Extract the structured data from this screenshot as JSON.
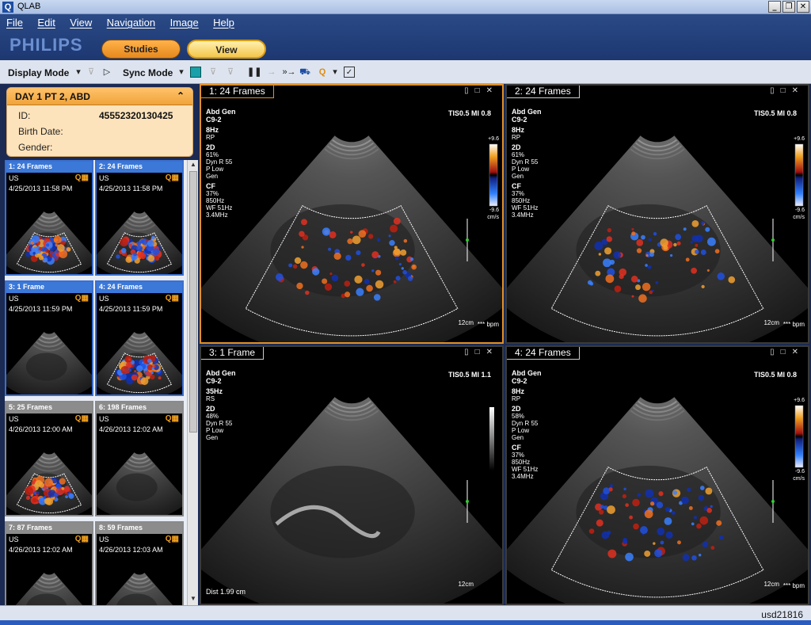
{
  "window": {
    "title": "QLAB",
    "icon_letter": "Q"
  },
  "menu": [
    "File",
    "Edit",
    "View",
    "Navigation",
    "Image",
    "Help"
  ],
  "brand": "PHILIPS",
  "tabs": {
    "studies": "Studies",
    "view": "View"
  },
  "toolbar": {
    "display_mode": "Display Mode",
    "sync_mode": "Sync Mode"
  },
  "patient": {
    "header": "DAY 1 PT 2, ABD",
    "id_label": "ID:",
    "id_value": "45552320130425",
    "birth_label": "Birth Date:",
    "gender_label": "Gender:"
  },
  "thumbnails": [
    {
      "title": "1: 24 Frames",
      "modality": "US",
      "date": "4/25/2013 11:58 PM",
      "selected": true,
      "doppler": true
    },
    {
      "title": "2: 24 Frames",
      "modality": "US",
      "date": "4/25/2013 11:58 PM",
      "selected": true,
      "doppler": true
    },
    {
      "title": "3: 1 Frame",
      "modality": "US",
      "date": "4/25/2013 11:59 PM",
      "selected": true,
      "doppler": false
    },
    {
      "title": "4: 24 Frames",
      "modality": "US",
      "date": "4/25/2013 11:59 PM",
      "selected": true,
      "doppler": true
    },
    {
      "title": "5: 25 Frames",
      "modality": "US",
      "date": "4/26/2013 12:00 AM",
      "selected": false,
      "doppler": true
    },
    {
      "title": "6: 198 Frames",
      "modality": "US",
      "date": "4/26/2013 12:02 AM",
      "selected": false,
      "doppler": false
    },
    {
      "title": "7: 87 Frames",
      "modality": "US",
      "date": "4/26/2013 12:02 AM",
      "selected": false,
      "doppler": false
    },
    {
      "title": "8: 59 Frames",
      "modality": "US",
      "date": "4/26/2013 12:03 AM",
      "selected": false,
      "doppler": false
    }
  ],
  "viewports": [
    {
      "tab": "1: 24 Frames",
      "preset": "Abd Gen",
      "probe": "C9-2",
      "tis": "TIS0.5   MI 0.8",
      "fps": "8Hz",
      "rp": "RP",
      "mode2d": "2D",
      "gain": "61%",
      "dyn": "Dyn R 55",
      "plow": "P Low",
      "gen": "Gen",
      "cf": "CF",
      "cfgain": "37%",
      "cfhz": "850Hz",
      "wf": "WF 51Hz",
      "mhz": "3.4MHz",
      "vel_top": "+9.6",
      "vel_bot": "-9.6",
      "vel_unit": "cm/s",
      "depth": "12cm",
      "bpm": "*** bpm",
      "doppler": true,
      "dist": ""
    },
    {
      "tab": "2: 24 Frames",
      "preset": "Abd Gen",
      "probe": "C9-2",
      "tis": "TIS0.5   MI 0.8",
      "fps": "8Hz",
      "rp": "RP",
      "mode2d": "2D",
      "gain": "61%",
      "dyn": "Dyn R 55",
      "plow": "P Low",
      "gen": "Gen",
      "cf": "CF",
      "cfgain": "37%",
      "cfhz": "850Hz",
      "wf": "WF 51Hz",
      "mhz": "3.4MHz",
      "vel_top": "+9.6",
      "vel_bot": "-9.6",
      "vel_unit": "cm/s",
      "depth": "12cm",
      "bpm": "*** bpm",
      "doppler": true,
      "dist": ""
    },
    {
      "tab": "3: 1 Frame",
      "preset": "Abd Gen",
      "probe": "C9-2",
      "tis": "TIS0.5   MI 1.1",
      "fps": "35Hz",
      "rp": "RS",
      "mode2d": "2D",
      "gain": "48%",
      "dyn": "Dyn R 55",
      "plow": "P Low",
      "gen": "Gen",
      "cf": "",
      "cfgain": "",
      "cfhz": "",
      "wf": "",
      "mhz": "",
      "vel_top": "",
      "vel_bot": "",
      "vel_unit": "",
      "depth": "12cm",
      "bpm": "",
      "doppler": false,
      "dist": "Dist   1.99 cm"
    },
    {
      "tab": "4: 24 Frames",
      "preset": "Abd Gen",
      "probe": "C9-2",
      "tis": "TIS0.5   MI 0.8",
      "fps": "8Hz",
      "rp": "RP",
      "mode2d": "2D",
      "gain": "58%",
      "dyn": "Dyn R 55",
      "plow": "P Low",
      "gen": "Gen",
      "cf": "CF",
      "cfgain": "37%",
      "cfhz": "850Hz",
      "wf": "WF 51Hz",
      "mhz": "3.4MHz",
      "vel_top": "+9.6",
      "vel_bot": "-9.6",
      "vel_unit": "cm/s",
      "depth": "12cm",
      "bpm": "*** bpm",
      "doppler": true,
      "dist": ""
    }
  ],
  "status": {
    "user": "usd21816"
  },
  "colors": {
    "header": "#1d3771",
    "accent_orange": "#e0902a",
    "thumb_selected": "#3b78d8"
  }
}
